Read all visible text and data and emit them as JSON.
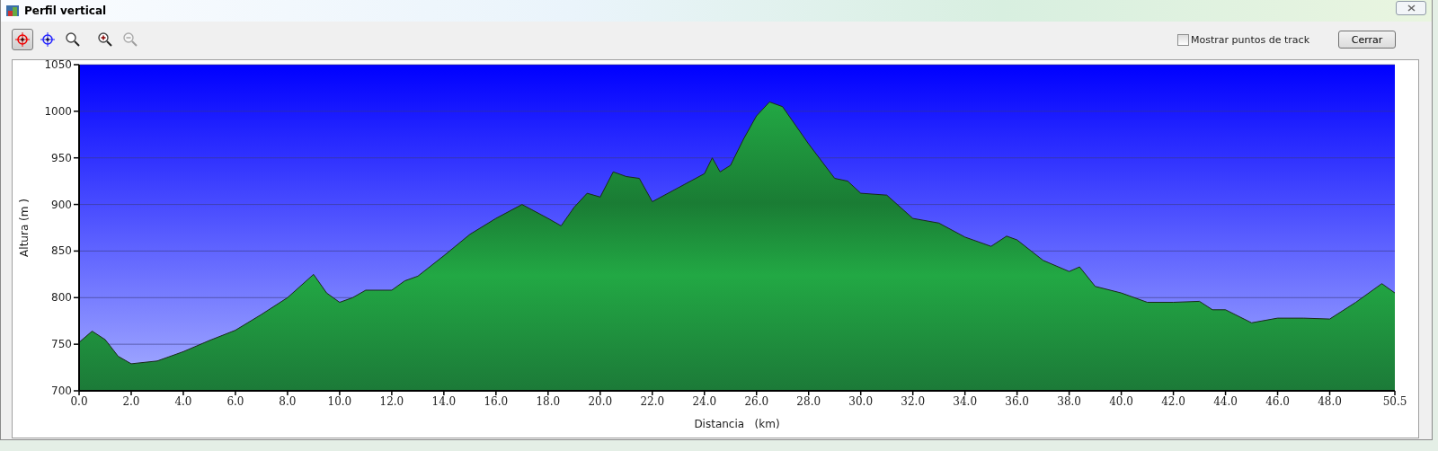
{
  "window": {
    "title": "Perfil vertical"
  },
  "toolbar": {
    "tools": [
      {
        "kind": "crosshair-red",
        "selected": true,
        "disabled": false
      },
      {
        "kind": "crosshair-blue",
        "selected": false,
        "disabled": false
      },
      {
        "kind": "zoom-box",
        "selected": false,
        "disabled": false
      },
      {
        "kind": "zoom-in",
        "selected": false,
        "disabled": false
      },
      {
        "kind": "zoom-out",
        "selected": false,
        "disabled": true
      }
    ],
    "checkbox": {
      "label": "Mostrar puntos de track",
      "checked": false
    },
    "close_button": "Cerrar"
  },
  "chart_data": {
    "type": "area",
    "xlabel": "Distancia   (km)",
    "ylabel": "Altura (m )",
    "x": [
      0,
      0.5,
      1,
      1.5,
      2,
      3,
      4,
      5,
      6,
      7,
      8,
      9,
      9.5,
      10,
      10.5,
      11,
      12,
      12.5,
      13,
      14,
      15,
      16,
      17,
      18,
      18.5,
      19,
      19.5,
      20,
      20.5,
      21,
      21.5,
      22,
      23,
      24,
      24.3,
      24.6,
      25,
      25.5,
      26,
      26.5,
      27,
      28,
      29,
      29.5,
      30,
      31,
      32,
      33,
      34,
      35,
      35.6,
      36,
      37,
      38,
      38.4,
      39,
      40,
      41,
      42,
      43,
      43.5,
      44,
      45,
      46,
      47,
      48,
      49,
      50,
      50.5
    ],
    "grid": true,
    "series": [
      {
        "color": "#22a844",
        "values": [
          752,
          764,
          755,
          737,
          729,
          732,
          742,
          754,
          765,
          782,
          800,
          825,
          805,
          795,
          800,
          808,
          808,
          818,
          823,
          845,
          868,
          885,
          900,
          885,
          877,
          897,
          912,
          908,
          935,
          930,
          928,
          903,
          918,
          933,
          950,
          935,
          942,
          970,
          995,
          1010,
          1005,
          965,
          928,
          925,
          912,
          910,
          885,
          880,
          865,
          855,
          866,
          862,
          840,
          828,
          833,
          812,
          805,
          795,
          795,
          796,
          787,
          787,
          773,
          778,
          778,
          777,
          795,
          815,
          805
        ]
      }
    ],
    "xlim": [
      0,
      50.5
    ],
    "ylim": [
      700,
      1050
    ],
    "xticks": [
      {
        "value": 0,
        "label": "0.0"
      },
      {
        "value": 2,
        "label": "2.0"
      },
      {
        "value": 4,
        "label": "4.0"
      },
      {
        "value": 6,
        "label": "6.0"
      },
      {
        "value": 8,
        "label": "8.0"
      },
      {
        "value": 10,
        "label": "10.0"
      },
      {
        "value": 12,
        "label": "12.0"
      },
      {
        "value": 14,
        "label": "14.0"
      },
      {
        "value": 16,
        "label": "16.0"
      },
      {
        "value": 18,
        "label": "18.0"
      },
      {
        "value": 20,
        "label": "20.0"
      },
      {
        "value": 22,
        "label": "22.0"
      },
      {
        "value": 24,
        "label": "24.0"
      },
      {
        "value": 26,
        "label": "26.0"
      },
      {
        "value": 28,
        "label": "28.0"
      },
      {
        "value": 30,
        "label": "30.0"
      },
      {
        "value": 32,
        "label": "32.0"
      },
      {
        "value": 34,
        "label": "34.0"
      },
      {
        "value": 36,
        "label": "36.0"
      },
      {
        "value": 38,
        "label": "38.0"
      },
      {
        "value": 40,
        "label": "40.0"
      },
      {
        "value": 42,
        "label": "42.0"
      },
      {
        "value": 44,
        "label": "44.0"
      },
      {
        "value": 46,
        "label": "46.0"
      },
      {
        "value": 48,
        "label": "48.0"
      },
      {
        "value": 50.5,
        "label": "50.5"
      }
    ],
    "yticks": [
      700,
      750,
      800,
      850,
      900,
      950,
      1000,
      1050
    ]
  }
}
